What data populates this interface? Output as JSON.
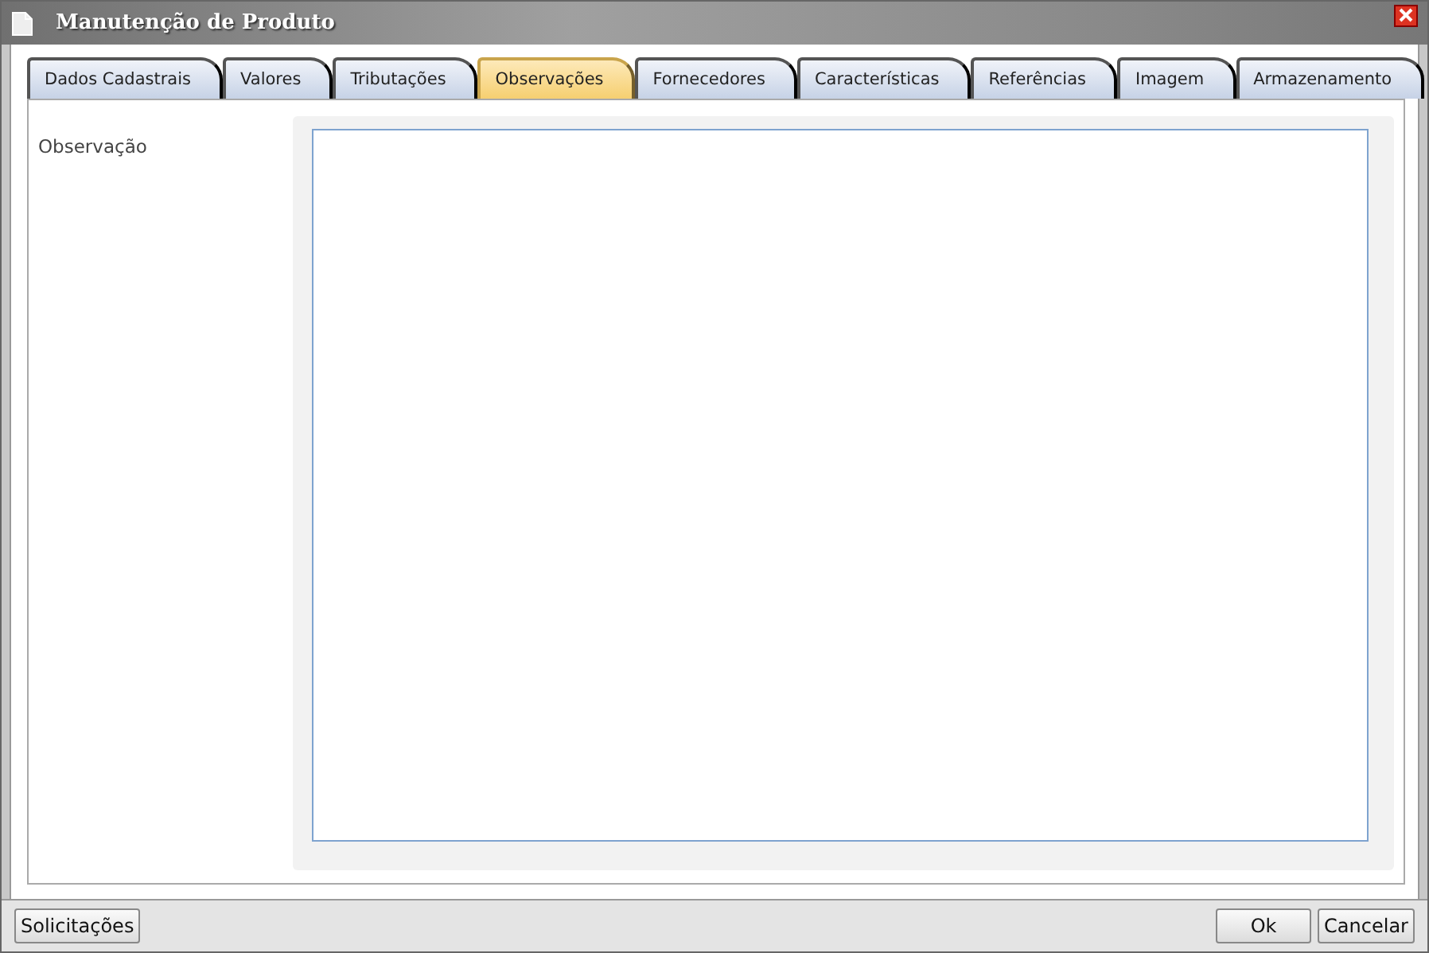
{
  "window": {
    "title": "Manutenção de Produto"
  },
  "tabs": [
    {
      "label": "Dados Cadastrais",
      "selected": false
    },
    {
      "label": "Valores",
      "selected": false
    },
    {
      "label": "Tributações",
      "selected": false
    },
    {
      "label": "Observações",
      "selected": true
    },
    {
      "label": "Fornecedores",
      "selected": false
    },
    {
      "label": "Características",
      "selected": false
    },
    {
      "label": "Referências",
      "selected": false
    },
    {
      "label": "Imagem",
      "selected": false
    },
    {
      "label": "Armazenamento",
      "selected": false
    }
  ],
  "field": {
    "label": "Observação"
  },
  "footer": {
    "left_button": "Solicitações",
    "buttons": [
      "Ok",
      "Cancelar"
    ]
  }
}
